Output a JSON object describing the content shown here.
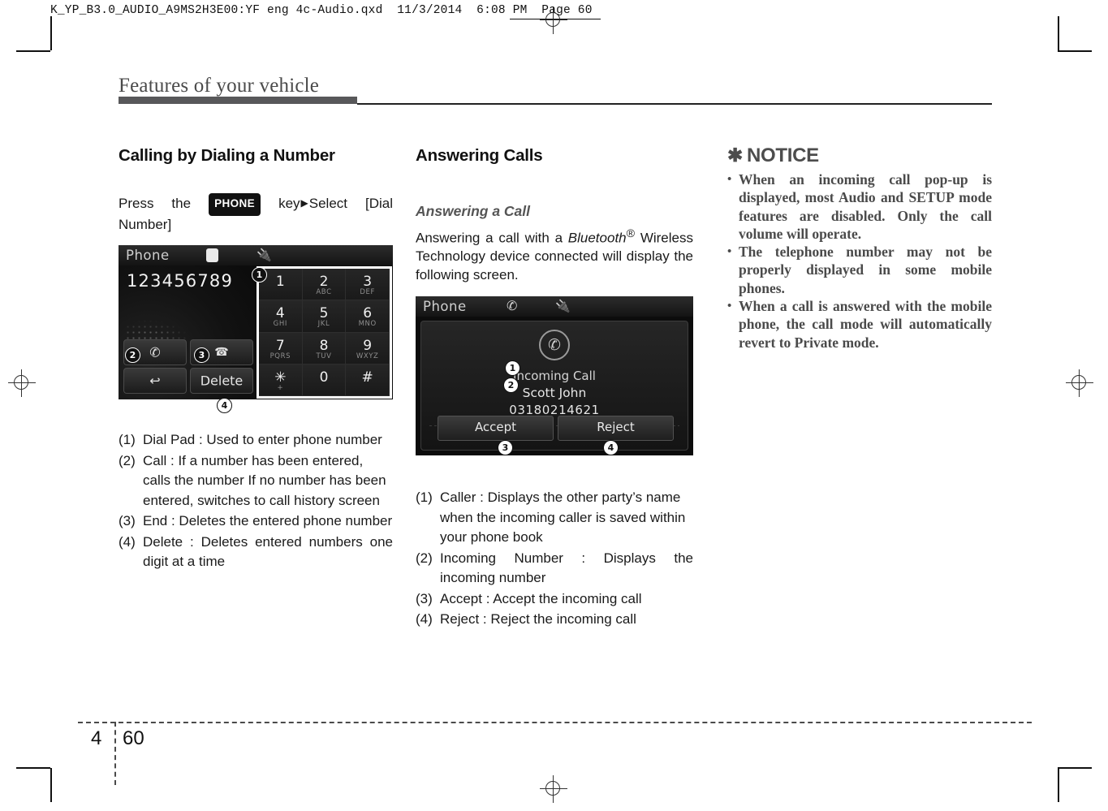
{
  "prepress": {
    "qxd_header": "K_YP_B3.0_AUDIO_A9MS2H3E00:YF eng 4c-Audio.qxd  11/3/2014  6:08 PM  Page 60"
  },
  "page": {
    "chapter_title": "Features of your vehicle",
    "footer_chapter": "4",
    "footer_page": "60"
  },
  "col1": {
    "heading": "Calling by Dialing a Number",
    "intro": {
      "before": "Press the",
      "key_label": "PHONE",
      "after_key": "key",
      "arrow": "▶",
      "after_arrow": "Select [Dial Number]"
    },
    "screen": {
      "title": "Phone",
      "bluetooth_icon": "bluetooth-icon",
      "usb_icon": "usb-icon",
      "entered_number": "123456789",
      "delete_label": "Delete",
      "call_icon": "call-handset-icon",
      "end_icon": "end-call-icon",
      "back_icon": "back-arrow-icon",
      "keypad": [
        {
          "digit": "1",
          "letters": ""
        },
        {
          "digit": "2",
          "letters": "ABC"
        },
        {
          "digit": "3",
          "letters": "DEF"
        },
        {
          "digit": "4",
          "letters": "GHI"
        },
        {
          "digit": "5",
          "letters": "JKL"
        },
        {
          "digit": "6",
          "letters": "MNO"
        },
        {
          "digit": "7",
          "letters": "PQRS"
        },
        {
          "digit": "8",
          "letters": "TUV"
        },
        {
          "digit": "9",
          "letters": "WXYZ"
        },
        {
          "digit": "✳",
          "letters": "+"
        },
        {
          "digit": "0",
          "letters": ""
        },
        {
          "digit": "#",
          "letters": ""
        }
      ],
      "callouts": [
        "1",
        "2",
        "3",
        "4"
      ]
    },
    "list": [
      {
        "num": "(1)",
        "text": "Dial Pad : Used to enter phone number",
        "align": "justify"
      },
      {
        "num": "(2)",
        "text": "Call : If a number has been entered, calls the number If no number has been entered, switches to call history screen",
        "align": "left"
      },
      {
        "num": "(3)",
        "text": "End : Deletes the entered phone number",
        "align": "justify"
      },
      {
        "num": "(4)",
        "text": "Delete : Deletes entered numbers one digit at a time",
        "align": "justify"
      }
    ]
  },
  "col2": {
    "heading": "Answering Calls",
    "subheading": "Answering a Call",
    "intro_part1": "Answering a call with a ",
    "intro_italic": "Bluetooth",
    "intro_sup": "®",
    "intro_part2": " Wireless Technology device connected will display the following screen.",
    "screen": {
      "title": "Phone",
      "call_icon": "call-handset-icon",
      "usb_icon": "usb-icon",
      "status": "Incoming Call",
      "caller_name": "Scott John",
      "caller_number": "03180214621",
      "accept_label": "Accept",
      "reject_label": "Reject",
      "callouts": [
        "1",
        "2",
        "3",
        "4"
      ]
    },
    "list": [
      {
        "num": "(1)",
        "text": "Caller : Displays the other party’s name when the incoming caller is saved within your phone book",
        "align": "left"
      },
      {
        "num": "(2)",
        "text": "Incoming Number : Displays the incoming number",
        "align": "justify"
      },
      {
        "num": "(3)",
        "text": "Accept : Accept the incoming call",
        "align": "left"
      },
      {
        "num": "(4)",
        "text": "Reject : Reject the incoming call",
        "align": "left"
      }
    ]
  },
  "col3": {
    "notice_marker": "✱",
    "notice_title": "NOTICE",
    "bullet": "•",
    "items": [
      "When an incoming call pop-up is displayed, most Audio and SETUP mode features are disabled. Only the call volume will operate.",
      "The telephone number may not be properly displayed in some mobile phones.",
      "When a call is answered with the mobile phone, the call mode will automatically revert to Private mode."
    ]
  },
  "colors": {
    "title_bar": "#58585a",
    "notice_text": "#4a4a4a",
    "key_badge": "#111111"
  }
}
